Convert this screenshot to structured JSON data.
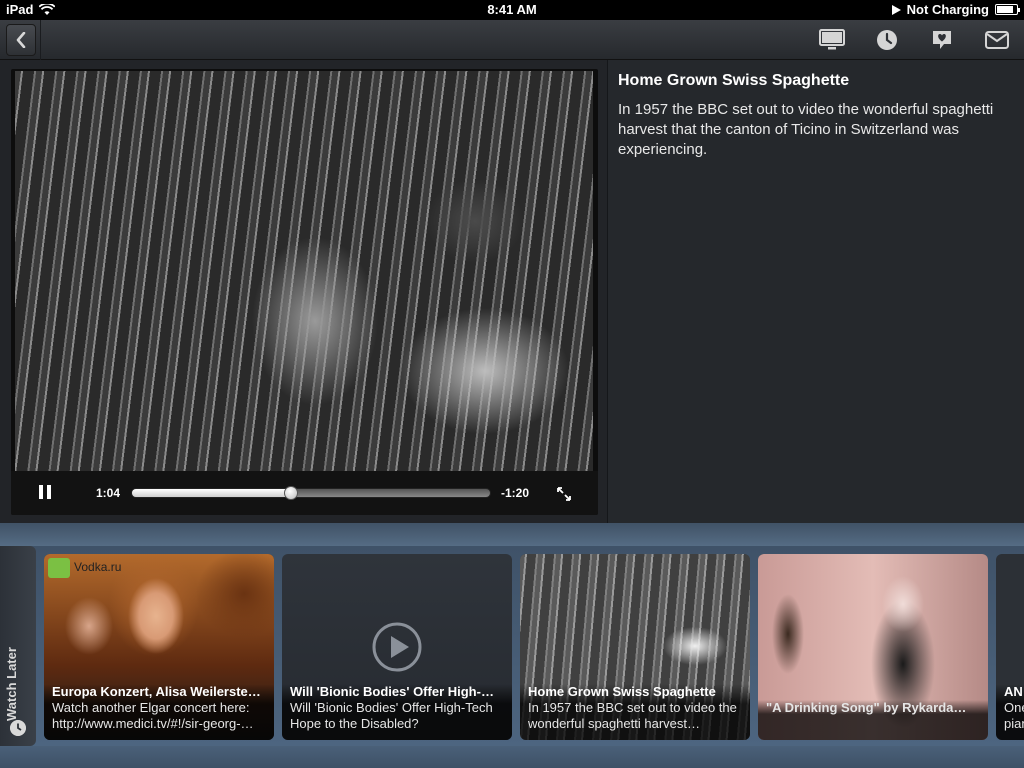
{
  "status_bar": {
    "device": "iPad",
    "time": "8:41 AM",
    "charging": "Not Charging",
    "battery_level": 0.85
  },
  "toolbar": {
    "icons": [
      "back-icon",
      "tv-icon",
      "clock-icon",
      "heart-icon",
      "mail-icon"
    ]
  },
  "player": {
    "elapsed": "1:04",
    "remaining": "-1:20",
    "progress": 0.444
  },
  "info": {
    "title": "Home Grown Swiss Spaghette",
    "description": "In 1957 the BBC set out to video the wonderful spaghetti harvest that the canton of Ticino in Switzerland was experiencing."
  },
  "shelf": {
    "tab_label": "Watch Later",
    "cards": [
      {
        "title": "Europa Konzert, Alisa Weilerste…",
        "description": "Watch another Elgar concert here: http://www.medici.tv/#!/sir-georg-…",
        "badge": "Vodka.ru"
      },
      {
        "title": "Will 'Bionic Bodies' Offer High-…",
        "description": "Will 'Bionic Bodies' Offer High-Tech Hope to the Disabled?"
      },
      {
        "title": "Home Grown Swiss Spaghette",
        "description": "In 1957 the BBC set out to video the wonderful spaghetti harvest…"
      },
      {
        "title": "",
        "description": "\"A Drinking Song\" by Rykarda…"
      },
      {
        "title": "AN",
        "description": "One pian"
      }
    ]
  },
  "colors": {
    "background": "#25282c",
    "shelf": "#4d6580",
    "badge_green": "#7bc043"
  }
}
